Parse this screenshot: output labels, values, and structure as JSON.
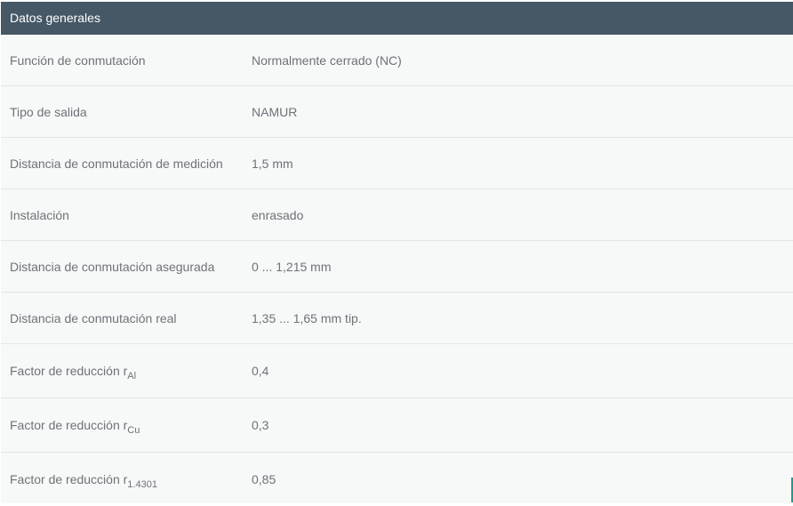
{
  "panel": {
    "title": "Datos generales"
  },
  "rows": [
    {
      "label": "Función de conmutación",
      "label_sub": "",
      "value": "Normalmente cerrado (NC)"
    },
    {
      "label": "Tipo de salida",
      "label_sub": "",
      "value": "NAMUR"
    },
    {
      "label": "Distancia de conmutación de medición",
      "label_sub": "",
      "value": "1,5 mm"
    },
    {
      "label": "Instalación",
      "label_sub": "",
      "value": "enrasado"
    },
    {
      "label": "Distancia de conmutación asegurada",
      "label_sub": "",
      "value": "0 ... 1,215 mm"
    },
    {
      "label": "Distancia de conmutación real",
      "label_sub": "",
      "value": "1,35 ... 1,65 mm tip."
    },
    {
      "label": "Factor de reducción r",
      "label_sub": "Al",
      "value": "0,4"
    },
    {
      "label": "Factor de reducción r",
      "label_sub": "Cu",
      "value": "0,3"
    },
    {
      "label": "Factor de reducción r",
      "label_sub": "1.4301",
      "value": "0,85"
    }
  ],
  "colors": {
    "header_bg": "#465866",
    "row_bg": "#f7f8f8",
    "text": "#6d7378",
    "divider": "#e2e6e8",
    "accent": "#1f9c8f"
  }
}
